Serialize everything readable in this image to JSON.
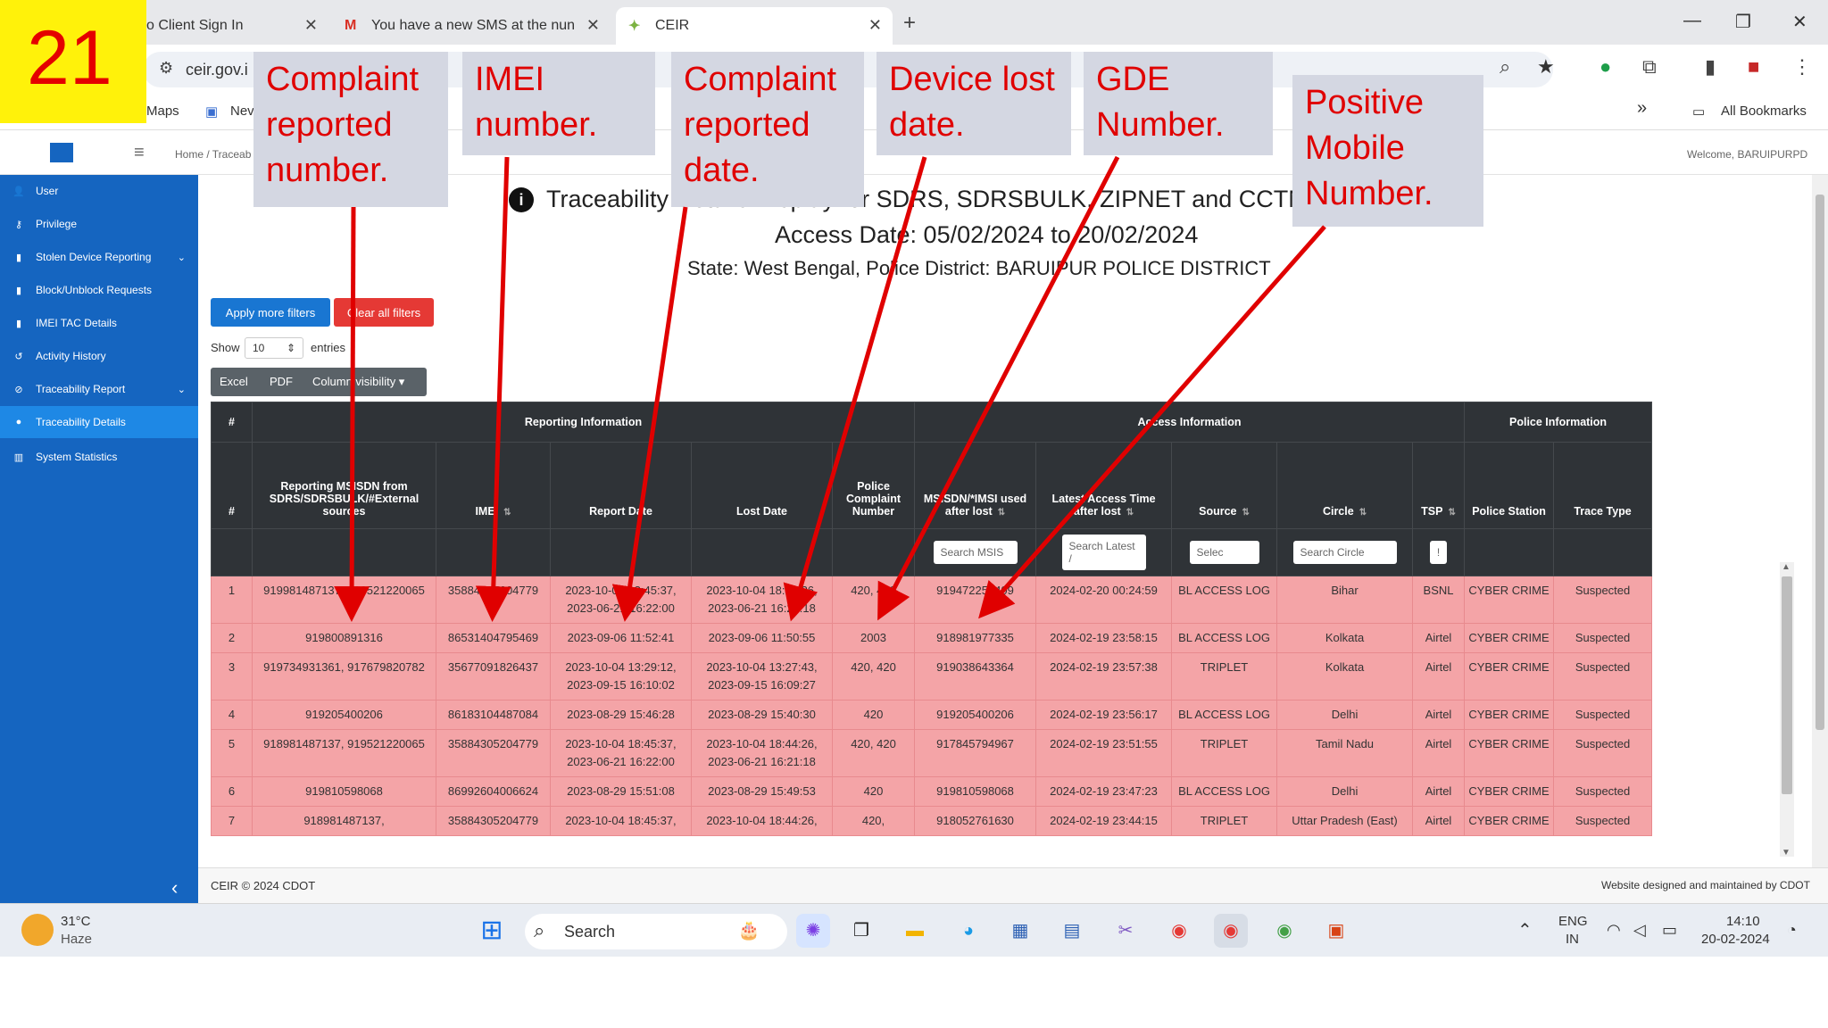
{
  "slide_number": "21",
  "callouts": [
    {
      "text": "Complaint reported number."
    },
    {
      "text": "IMEI number."
    },
    {
      "text": "Complaint reported date."
    },
    {
      "text": "Device lost date."
    },
    {
      "text": "GDE Number."
    },
    {
      "text": "Positive Mobile Number."
    }
  ],
  "browser": {
    "tabs": [
      {
        "label": "o Client Sign In"
      },
      {
        "label": "You have a new SMS at the nun"
      },
      {
        "label": "CEIR"
      }
    ],
    "address": "ceir.gov.i",
    "bookmarks": [
      "Maps",
      "Nev"
    ],
    "all_bookmarks": "All Bookmarks"
  },
  "app": {
    "breadcrumb": "Home / Traceab",
    "welcome": "Welcome, BARUIPURPD",
    "title": "Traceability Details Display for SDRS, SDRSBULK, ZIPNET and CCTNS Details",
    "access_date": "Access Date: 05/02/2024 to 20/02/2024",
    "state_line": "State: West Bengal, Police District: BARUIPUR POLICE DISTRICT"
  },
  "sidebar": {
    "items": [
      {
        "label": "User",
        "icon": "user-icon"
      },
      {
        "label": "Privilege",
        "icon": "key-icon"
      },
      {
        "label": "Stolen Device Reporting",
        "icon": "phone-icon",
        "chevron": true
      },
      {
        "label": "Block/Unblock Requests",
        "icon": "phone-icon"
      },
      {
        "label": "IMEI TAC Details",
        "icon": "phone-icon"
      },
      {
        "label": "Activity History",
        "icon": "history-icon"
      },
      {
        "label": "Traceability Report",
        "icon": "compass-icon",
        "chevron": true
      },
      {
        "label": "Traceability Details",
        "icon": "dot-icon",
        "active": true
      },
      {
        "label": "System Statistics",
        "icon": "chart-icon"
      }
    ]
  },
  "controls": {
    "apply_filters": "Apply more filters",
    "clear_filters": "Clear all filters",
    "show": "Show",
    "entries_value": "10",
    "entries": "entries",
    "export_buttons": [
      "Excel",
      "PDF",
      "Column visibility ▾"
    ]
  },
  "table": {
    "groups": [
      "#",
      "Reporting Information",
      "Access Information",
      "Police Information"
    ],
    "columns": [
      "#",
      "Reporting MSISDN from SDRS/SDRSBULK/#External sources",
      "IMEI",
      "Report Date",
      "Lost Date",
      "Police Complaint Number",
      "MSISDN/*IMSI used after lost",
      "Latest Access Time after lost",
      "Source",
      "Circle",
      "TSP",
      "Police Station",
      "Trace Type"
    ],
    "search_placeholders": [
      "",
      "",
      "",
      "",
      "",
      "",
      "Search MSIS",
      "Search Latest /",
      "Selec",
      "Search Circle",
      "!",
      "",
      ""
    ],
    "rows": [
      [
        "1",
        "919981487137, 919521220065",
        "35884305204779",
        "2023-10-04 18:45:37, 2023-06-21 16:22:00",
        "2023-10-04 18:44:26, 2023-06-21 16:21:18",
        "420, 420",
        "919472252409",
        "2024-02-20 00:24:59",
        "BL ACCESS LOG",
        "Bihar",
        "BSNL",
        "CYBER CRIME",
        "Suspected"
      ],
      [
        "2",
        "919800891316",
        "86531404795469",
        "2023-09-06 11:52:41",
        "2023-09-06 11:50:55",
        "2003",
        "918981977335",
        "2024-02-19 23:58:15",
        "BL ACCESS LOG",
        "Kolkata",
        "Airtel",
        "CYBER CRIME",
        "Suspected"
      ],
      [
        "3",
        "919734931361, 917679820782",
        "35677091826437",
        "2023-10-04 13:29:12, 2023-09-15 16:10:02",
        "2023-10-04 13:27:43, 2023-09-15 16:09:27",
        "420, 420",
        "919038643364",
        "2024-02-19 23:57:38",
        "TRIPLET",
        "Kolkata",
        "Airtel",
        "CYBER CRIME",
        "Suspected"
      ],
      [
        "4",
        "919205400206",
        "86183104487084",
        "2023-08-29 15:46:28",
        "2023-08-29 15:40:30",
        "420",
        "919205400206",
        "2024-02-19 23:56:17",
        "BL ACCESS LOG",
        "Delhi",
        "Airtel",
        "CYBER CRIME",
        "Suspected"
      ],
      [
        "5",
        "918981487137, 919521220065",
        "35884305204779",
        "2023-10-04 18:45:37, 2023-06-21 16:22:00",
        "2023-10-04 18:44:26, 2023-06-21 16:21:18",
        "420, 420",
        "917845794967",
        "2024-02-19 23:51:55",
        "TRIPLET",
        "Tamil Nadu",
        "Airtel",
        "CYBER CRIME",
        "Suspected"
      ],
      [
        "6",
        "919810598068",
        "86992604006624",
        "2023-08-29 15:51:08",
        "2023-08-29 15:49:53",
        "420",
        "919810598068",
        "2024-02-19 23:47:23",
        "BL ACCESS LOG",
        "Delhi",
        "Airtel",
        "CYBER CRIME",
        "Suspected"
      ],
      [
        "7",
        "918981487137,",
        "35884305204779",
        "2023-10-04 18:45:37,",
        "2023-10-04 18:44:26,",
        "420,",
        "918052761630",
        "2024-02-19 23:44:15",
        "TRIPLET",
        "Uttar Pradesh (East)",
        "Airtel",
        "CYBER CRIME",
        "Suspected"
      ]
    ]
  },
  "footer": {
    "left": "CEIR © 2024 CDOT",
    "right": "Website designed and maintained by CDOT"
  },
  "taskbar": {
    "weather_temp": "31°C",
    "weather_desc": "Haze",
    "search": "Search",
    "lang1": "ENG",
    "lang2": "IN",
    "time": "14:10",
    "date": "20-02-2024"
  },
  "colors": {
    "sidebar": "#1565c0",
    "row_highlight": "#f4a4a7",
    "annotation": "#e00000",
    "table_header": "#2f3337"
  }
}
